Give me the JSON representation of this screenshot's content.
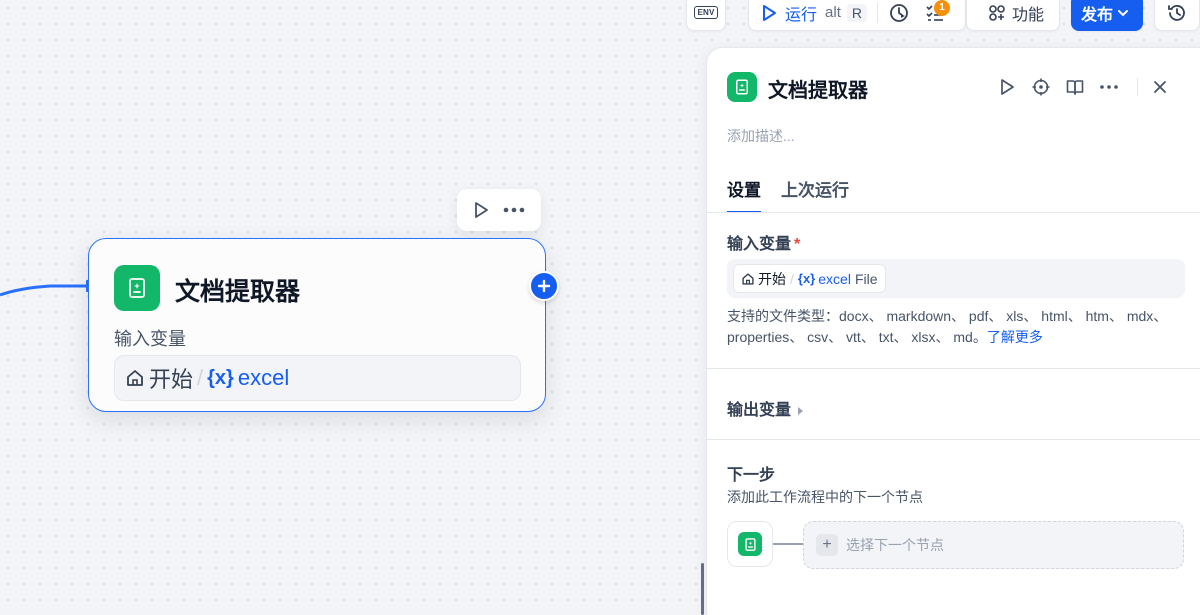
{
  "toolbar": {
    "env_label": "ENV",
    "run_label": "运行",
    "run_shortcut_mod": "alt",
    "run_shortcut_key": "R",
    "checklist_badge": "1",
    "features_label": "功能",
    "publish_label": "发布"
  },
  "node": {
    "title": "文档提取器",
    "input_label": "输入变量",
    "source_node": "开始",
    "var_icon": "{x}",
    "var_name": "excel"
  },
  "panel": {
    "title": "文档提取器",
    "description_placeholder": "添加描述...",
    "tabs": [
      {
        "label": "设置",
        "active": true
      },
      {
        "label": "上次运行",
        "active": false
      }
    ],
    "input_section": {
      "title": "输入变量",
      "required_mark": "*",
      "source_node": "开始",
      "var_icon": "{x}",
      "var_name": "excel",
      "var_type": "File",
      "hint": "支持的文件类型：docx、 markdown、 pdf、 xls、 html、 htm、 mdx、 properties、 csv、 vtt、 txt、 xlsx、 md。",
      "learn_more": "了解更多"
    },
    "output_section": {
      "title": "输出变量"
    },
    "next_section": {
      "title": "下一步",
      "subtitle": "添加此工作流程中的下一个节点",
      "select_label": "选择下一个节点"
    }
  },
  "colors": {
    "accent": "#155eef",
    "node_green": "#12b76a",
    "badge_orange": "#f79009",
    "required_red": "#f04438"
  },
  "icons": [
    "env-icon",
    "play-icon",
    "checklist-icon",
    "features-icon",
    "chevron-down-icon",
    "history-icon",
    "more-icon",
    "plus-icon",
    "document-extractor-icon",
    "home-icon",
    "variable-icon",
    "locate-icon",
    "book-icon",
    "close-icon",
    "caret-right-icon"
  ]
}
